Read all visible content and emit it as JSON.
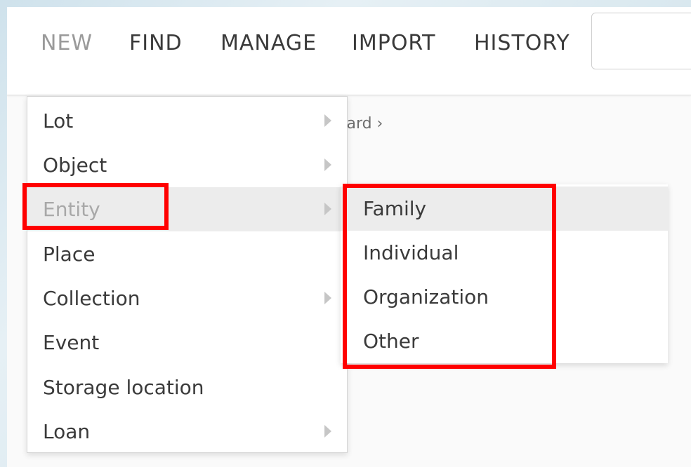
{
  "nav": {
    "items": [
      {
        "label": "NEW",
        "active": true
      },
      {
        "label": "FIND",
        "active": false
      },
      {
        "label": "MANAGE",
        "active": false
      },
      {
        "label": "IMPORT",
        "active": false
      },
      {
        "label": "HISTORY",
        "active": false
      }
    ],
    "search_value": ""
  },
  "breadcrumb": {
    "text": "oard ›"
  },
  "new_menu": {
    "items": [
      {
        "label": "Lot",
        "has_submenu": true
      },
      {
        "label": "Object",
        "has_submenu": true
      },
      {
        "label": "Entity",
        "has_submenu": true,
        "hovered": true
      },
      {
        "label": "Place",
        "has_submenu": false
      },
      {
        "label": "Collection",
        "has_submenu": true
      },
      {
        "label": "Event",
        "has_submenu": false
      },
      {
        "label": "Storage location",
        "has_submenu": false
      },
      {
        "label": "Loan",
        "has_submenu": true
      }
    ]
  },
  "entity_submenu": {
    "items": [
      {
        "label": "Family",
        "hovered": true
      },
      {
        "label": "Individual"
      },
      {
        "label": "Organization"
      },
      {
        "label": "Other"
      }
    ]
  },
  "annotation": {
    "color": "#ff0000"
  }
}
